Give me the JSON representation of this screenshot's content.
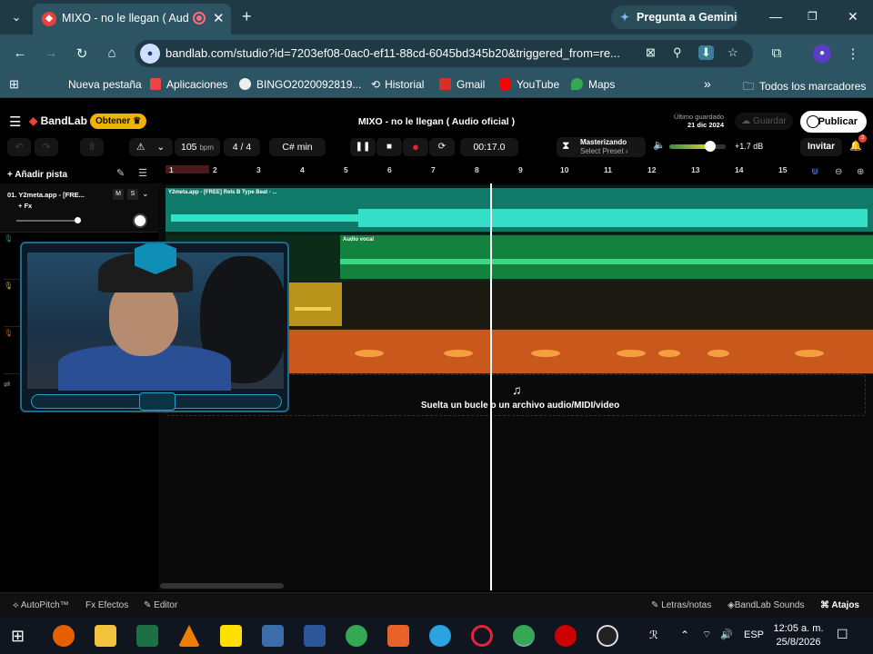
{
  "browser": {
    "tab_title": "MIXO - no le llegan ( Audio",
    "tab_close": "✕",
    "new_tab": "+",
    "gemini_label": "Pregunta a Gemini",
    "url": "bandlab.com/studio?id=7203ef08-0ac0-ef11-88cd-6045bd345b20&triggered_from=re...",
    "bookmarks": [
      "Nueva pestaña",
      "Aplicaciones",
      "BINGO2020092819...",
      "Historial",
      "Gmail",
      "YouTube",
      "Maps"
    ],
    "all_bookmarks": "Todos los marcadores",
    "more_bookmarks": "»"
  },
  "app": {
    "logo": "BandLab",
    "obtener": "Obtener ♛",
    "project_title": "MIXO - no le llegan ( Audio oficial )",
    "saved_label": "Último guardado",
    "saved_date": "21 dic 2024",
    "guardar": "Guardar",
    "publicar": "Publicar"
  },
  "toolbar": {
    "bpm_value": "105",
    "bpm_unit": "bpm",
    "time_sig": "4 / 4",
    "key": "C# min",
    "time": "00:17.0",
    "master_title": "Masterizando",
    "master_sub": "Select Preset ›",
    "master_level": 0.72,
    "db": "+1.7 dB",
    "invitar": "Invitar",
    "notif_count": "3"
  },
  "tracks": {
    "add_track": "Añadir pista",
    "ruler": [
      "1",
      "2",
      "3",
      "4",
      "5",
      "6",
      "7",
      "8",
      "9",
      "10",
      "11",
      "12",
      "13",
      "14",
      "15"
    ],
    "track1_name": "01. Y2meta.app - [FRE...",
    "track1_fx": "+ Fx",
    "track1_m": "M",
    "track1_s": "S",
    "clip1_name": "Y2meta.app - [FREE] Rels B Type Beat - ...",
    "clip2_name": "Audio vocal",
    "drop_text": "Suelta un bucle o un archivo audio/MIDI/video",
    "colors": {
      "track1": "#1aa58f",
      "track2": "#1e9a4e",
      "track3": "#c5a21b",
      "track4": "#c8581b"
    }
  },
  "bottom": {
    "autopitch": "AutoPitch™",
    "efectos": "Efectos",
    "editor": "Editor",
    "letras": "Letras/notas",
    "sounds": "BandLab Sounds",
    "atajos": "Atajos"
  },
  "taskbar": {
    "lang": "ESP",
    "time": "12:05 a. m.",
    "date": "25/8/2026"
  }
}
